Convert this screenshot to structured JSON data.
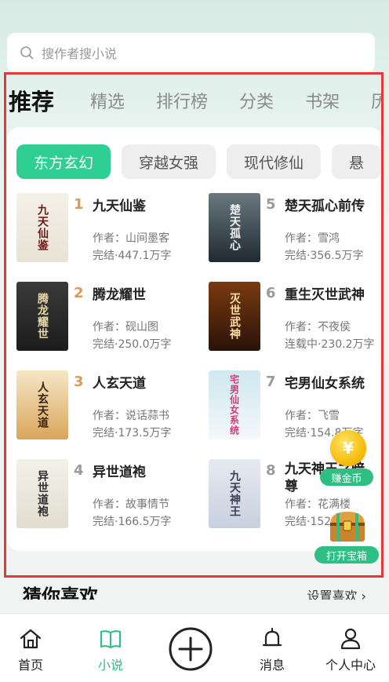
{
  "search": {
    "placeholder": "搜作者搜小说"
  },
  "tabs": [
    "推荐",
    "精选",
    "排行榜",
    "分类",
    "书架",
    "历"
  ],
  "chips": [
    "东方玄幻",
    "穿越女强",
    "现代修仙",
    "悬"
  ],
  "books": [
    {
      "rank": "1",
      "title": "九天仙鉴",
      "author": "作者：山间墨客",
      "status": "完结·447.1万字",
      "cover_text": "九天仙鉴"
    },
    {
      "rank": "2",
      "title": "腾龙耀世",
      "author": "作者：砚山图",
      "status": "完结·250.0万字",
      "cover_text": "腾龙耀世"
    },
    {
      "rank": "3",
      "title": "人玄天道",
      "author": "作者：说话蒜书",
      "status": "完结·173.5万字",
      "cover_text": "人玄天道"
    },
    {
      "rank": "4",
      "title": "异世道袍",
      "author": "作者：故事情节",
      "status": "完结·166.5万字",
      "cover_text": "异世道袍"
    },
    {
      "rank": "5",
      "title": "楚天孤心前传",
      "author": "作者：雪鸿",
      "status": "完结·356.5万字",
      "cover_text": "楚天孤心"
    },
    {
      "rank": "6",
      "title": "重生灭世武神",
      "author": "作者：不夜侯",
      "status": "连载中·230.2万字",
      "cover_text": "灭世武神"
    },
    {
      "rank": "7",
      "title": "宅男仙女系统",
      "author": "作者：飞雪",
      "status": "完结·154.8万字",
      "cover_text": "宅男仙女系统"
    },
    {
      "rank": "8",
      "title": "九天神王之暗尊",
      "author": "作者：花满楼",
      "status": "完结·152",
      "cover_text": "九天神王"
    }
  ],
  "float": {
    "coin_symbol": "¥",
    "earn_label": "赚金币",
    "chest_label": "打开宝箱"
  },
  "guess": {
    "title": "猜你喜欢",
    "link": "设置喜欢 ›"
  },
  "bottom_nav": [
    {
      "label": "首页",
      "icon": "home-icon"
    },
    {
      "label": "小说",
      "icon": "book-icon"
    },
    {
      "label": "",
      "icon": "plus-circle-icon"
    },
    {
      "label": "消息",
      "icon": "bell-icon"
    },
    {
      "label": "个人中心",
      "icon": "person-icon"
    }
  ],
  "colors": {
    "accent": "#2fcf94",
    "nav_active": "#2fbf84",
    "rank_gold": "#d79a5a",
    "frame": "#e0393e"
  }
}
